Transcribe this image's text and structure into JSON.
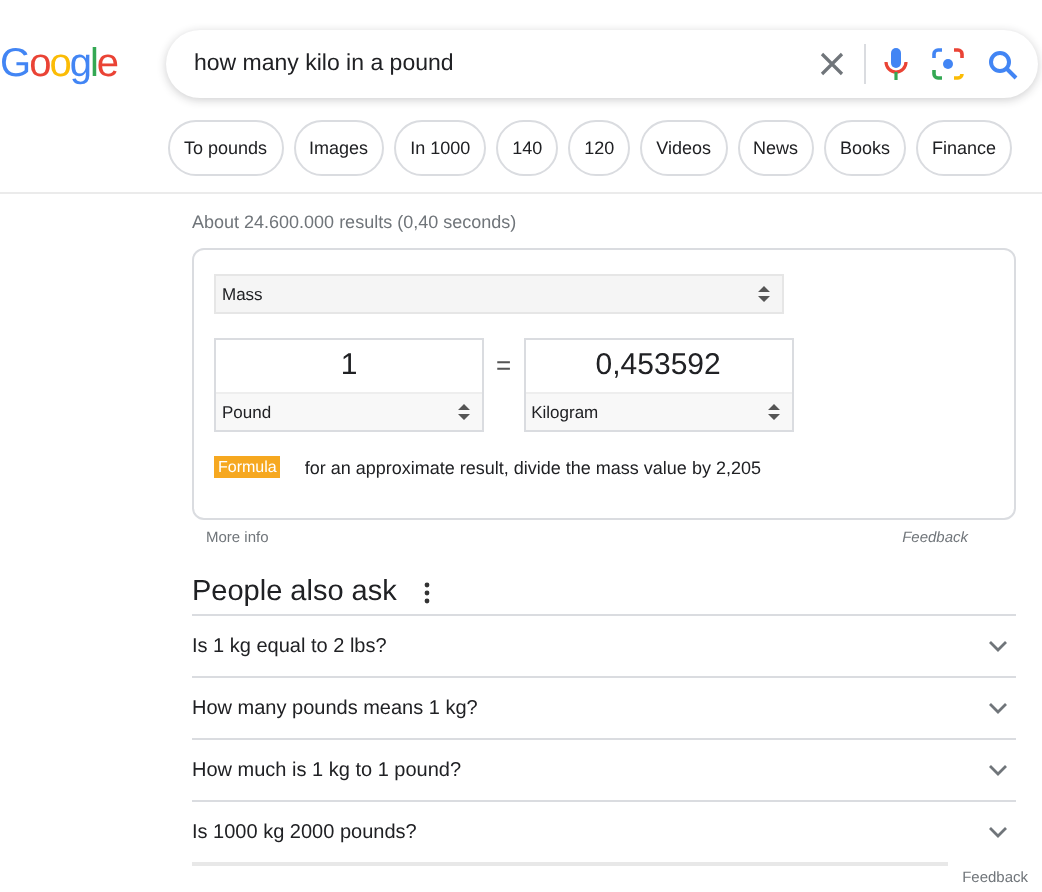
{
  "logo": "Google",
  "search": {
    "value": "how many kilo in a pound"
  },
  "chips": [
    {
      "label": "To pounds"
    },
    {
      "label": "Images"
    },
    {
      "label": "In 1000"
    },
    {
      "label": "140"
    },
    {
      "label": "120"
    },
    {
      "label": "Videos"
    },
    {
      "label": "News"
    },
    {
      "label": "Books"
    },
    {
      "label": "Finance"
    }
  ],
  "result_stats": "About 24.600.000 results (0,40 seconds)",
  "converter": {
    "quantity": "Mass",
    "from_value": "1",
    "from_unit": "Pound",
    "equals": "=",
    "to_value": "0,453592",
    "to_unit": "Kilogram",
    "formula_badge": "Formula",
    "formula_text": "for an approximate result, divide the mass value by 2,205"
  },
  "more_info": "More info",
  "converter_feedback": "Feedback",
  "people_also_ask": {
    "title": "People also ask",
    "questions": [
      {
        "text": "Is 1 kg equal to 2 lbs?",
        "expanded": false
      },
      {
        "text": "How many pounds means 1 kg?",
        "expanded": false
      },
      {
        "text": "How much is 1 kg to 1 pound?",
        "expanded": false
      },
      {
        "text": "Is 1000 kg 2000 pounds?",
        "expanded": false
      }
    ],
    "feedback": "Feedback"
  }
}
